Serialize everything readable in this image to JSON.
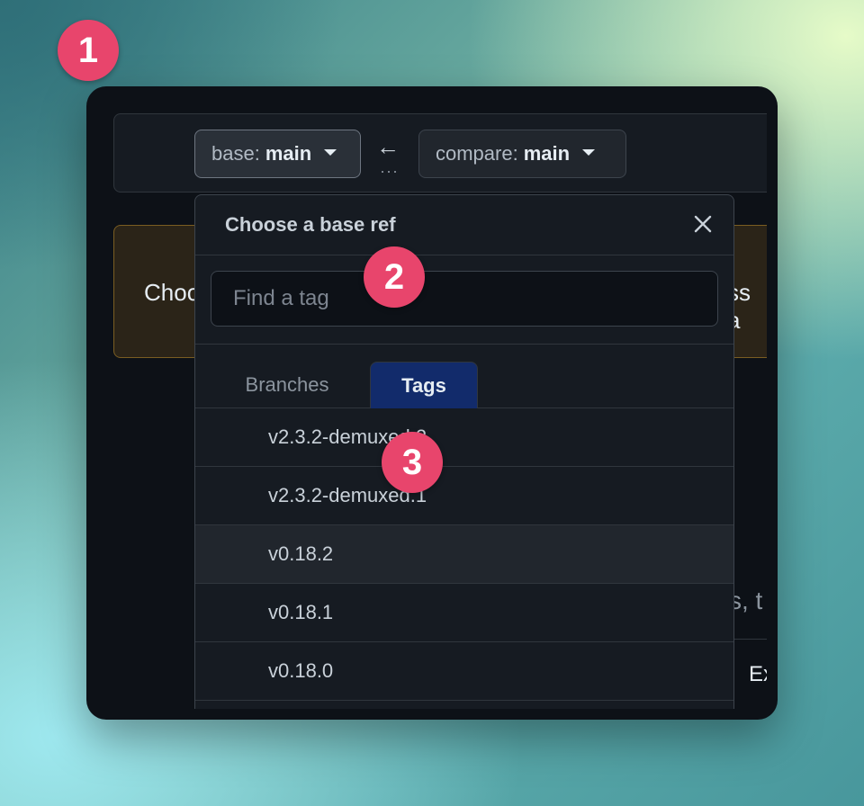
{
  "range_bar": {
    "base_prefix": "base:",
    "base_ref": "main",
    "compare_prefix": "compare:",
    "compare_ref": "main",
    "arrow_glyph": "←",
    "dots_glyph": "···"
  },
  "background": {
    "notice_left": "Choo",
    "notice_right": "ss a",
    "partial_right": "s, t",
    "partial_ex": "Ex"
  },
  "dropdown": {
    "title": "Choose a base ref",
    "filter_placeholder": "Find a tag",
    "filter_value": "",
    "tabs": [
      {
        "label": "Branches",
        "selected": false
      },
      {
        "label": "Tags",
        "selected": true
      }
    ],
    "items": [
      {
        "label": "v2.3.2-demuxed.2"
      },
      {
        "label": "v2.3.2-demuxed.1"
      },
      {
        "label": "v0.18.2"
      },
      {
        "label": "v0.18.1"
      },
      {
        "label": "v0.18.0"
      }
    ]
  },
  "markers": [
    "1",
    "2",
    "3"
  ],
  "colors": {
    "marker": "#e8456c",
    "selected_tab": "#122b6b",
    "window_bg": "#0d1117"
  }
}
